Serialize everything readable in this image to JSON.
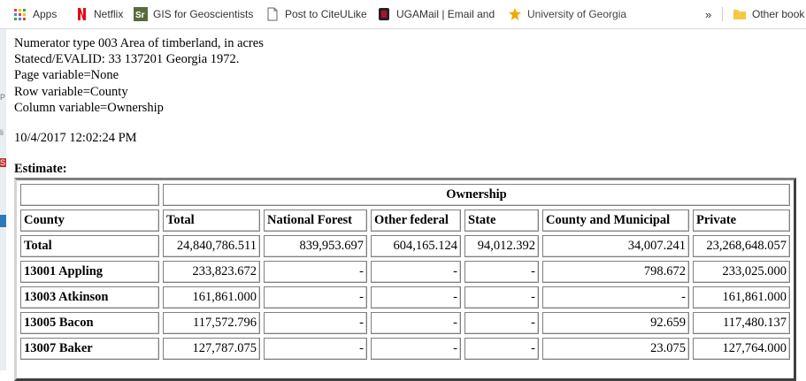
{
  "bookmarks": {
    "items": [
      {
        "label": "Apps"
      },
      {
        "label": "Netflix"
      },
      {
        "label": "GIS for Geoscientists"
      },
      {
        "label": "Post to CiteULike"
      },
      {
        "label": "UGAMail | Email and"
      },
      {
        "label": "University of Georgia"
      }
    ],
    "overflow": "»",
    "other": "Other book"
  },
  "report": {
    "lines": [
      "Numerator type 003 Area of timberland, in acres",
      "Statecd/EVALID: 33 137201 Georgia 1972.",
      "Page variable=None",
      "Row variable=County",
      "Column variable=Ownership"
    ],
    "timestamp": "10/4/2017 12:02:24 PM",
    "estimate_label": "Estimate:"
  },
  "table": {
    "group_header": "Ownership",
    "columns": [
      "County",
      "Total",
      "National Forest",
      "Other federal",
      "State",
      "County and Municipal",
      "Private"
    ],
    "rows": [
      [
        "Total",
        "24,840,786.511",
        "839,953.697",
        "604,165.124",
        "94,012.392",
        "34,007.241",
        "23,268,648.057"
      ],
      [
        "13001 Appling",
        "233,823.672",
        "-",
        "-",
        "-",
        "798.672",
        "233,025.000"
      ],
      [
        "13003 Atkinson",
        "161,861.000",
        "-",
        "-",
        "-",
        "-",
        "161,861.000"
      ],
      [
        "13005 Bacon",
        "117,572.796",
        "-",
        "-",
        "-",
        "92.659",
        "117,480.137"
      ],
      [
        "13007 Baker",
        "127,787.075",
        "-",
        "-",
        "-",
        "23.075",
        "127,764.000"
      ]
    ]
  },
  "colors": {
    "netflix_red": "#e50914",
    "gis_green": "#5a6b3a",
    "uga_red": "#ba0c2f",
    "uga_star": "#f2a900",
    "folder_yellow": "#f5c842"
  }
}
